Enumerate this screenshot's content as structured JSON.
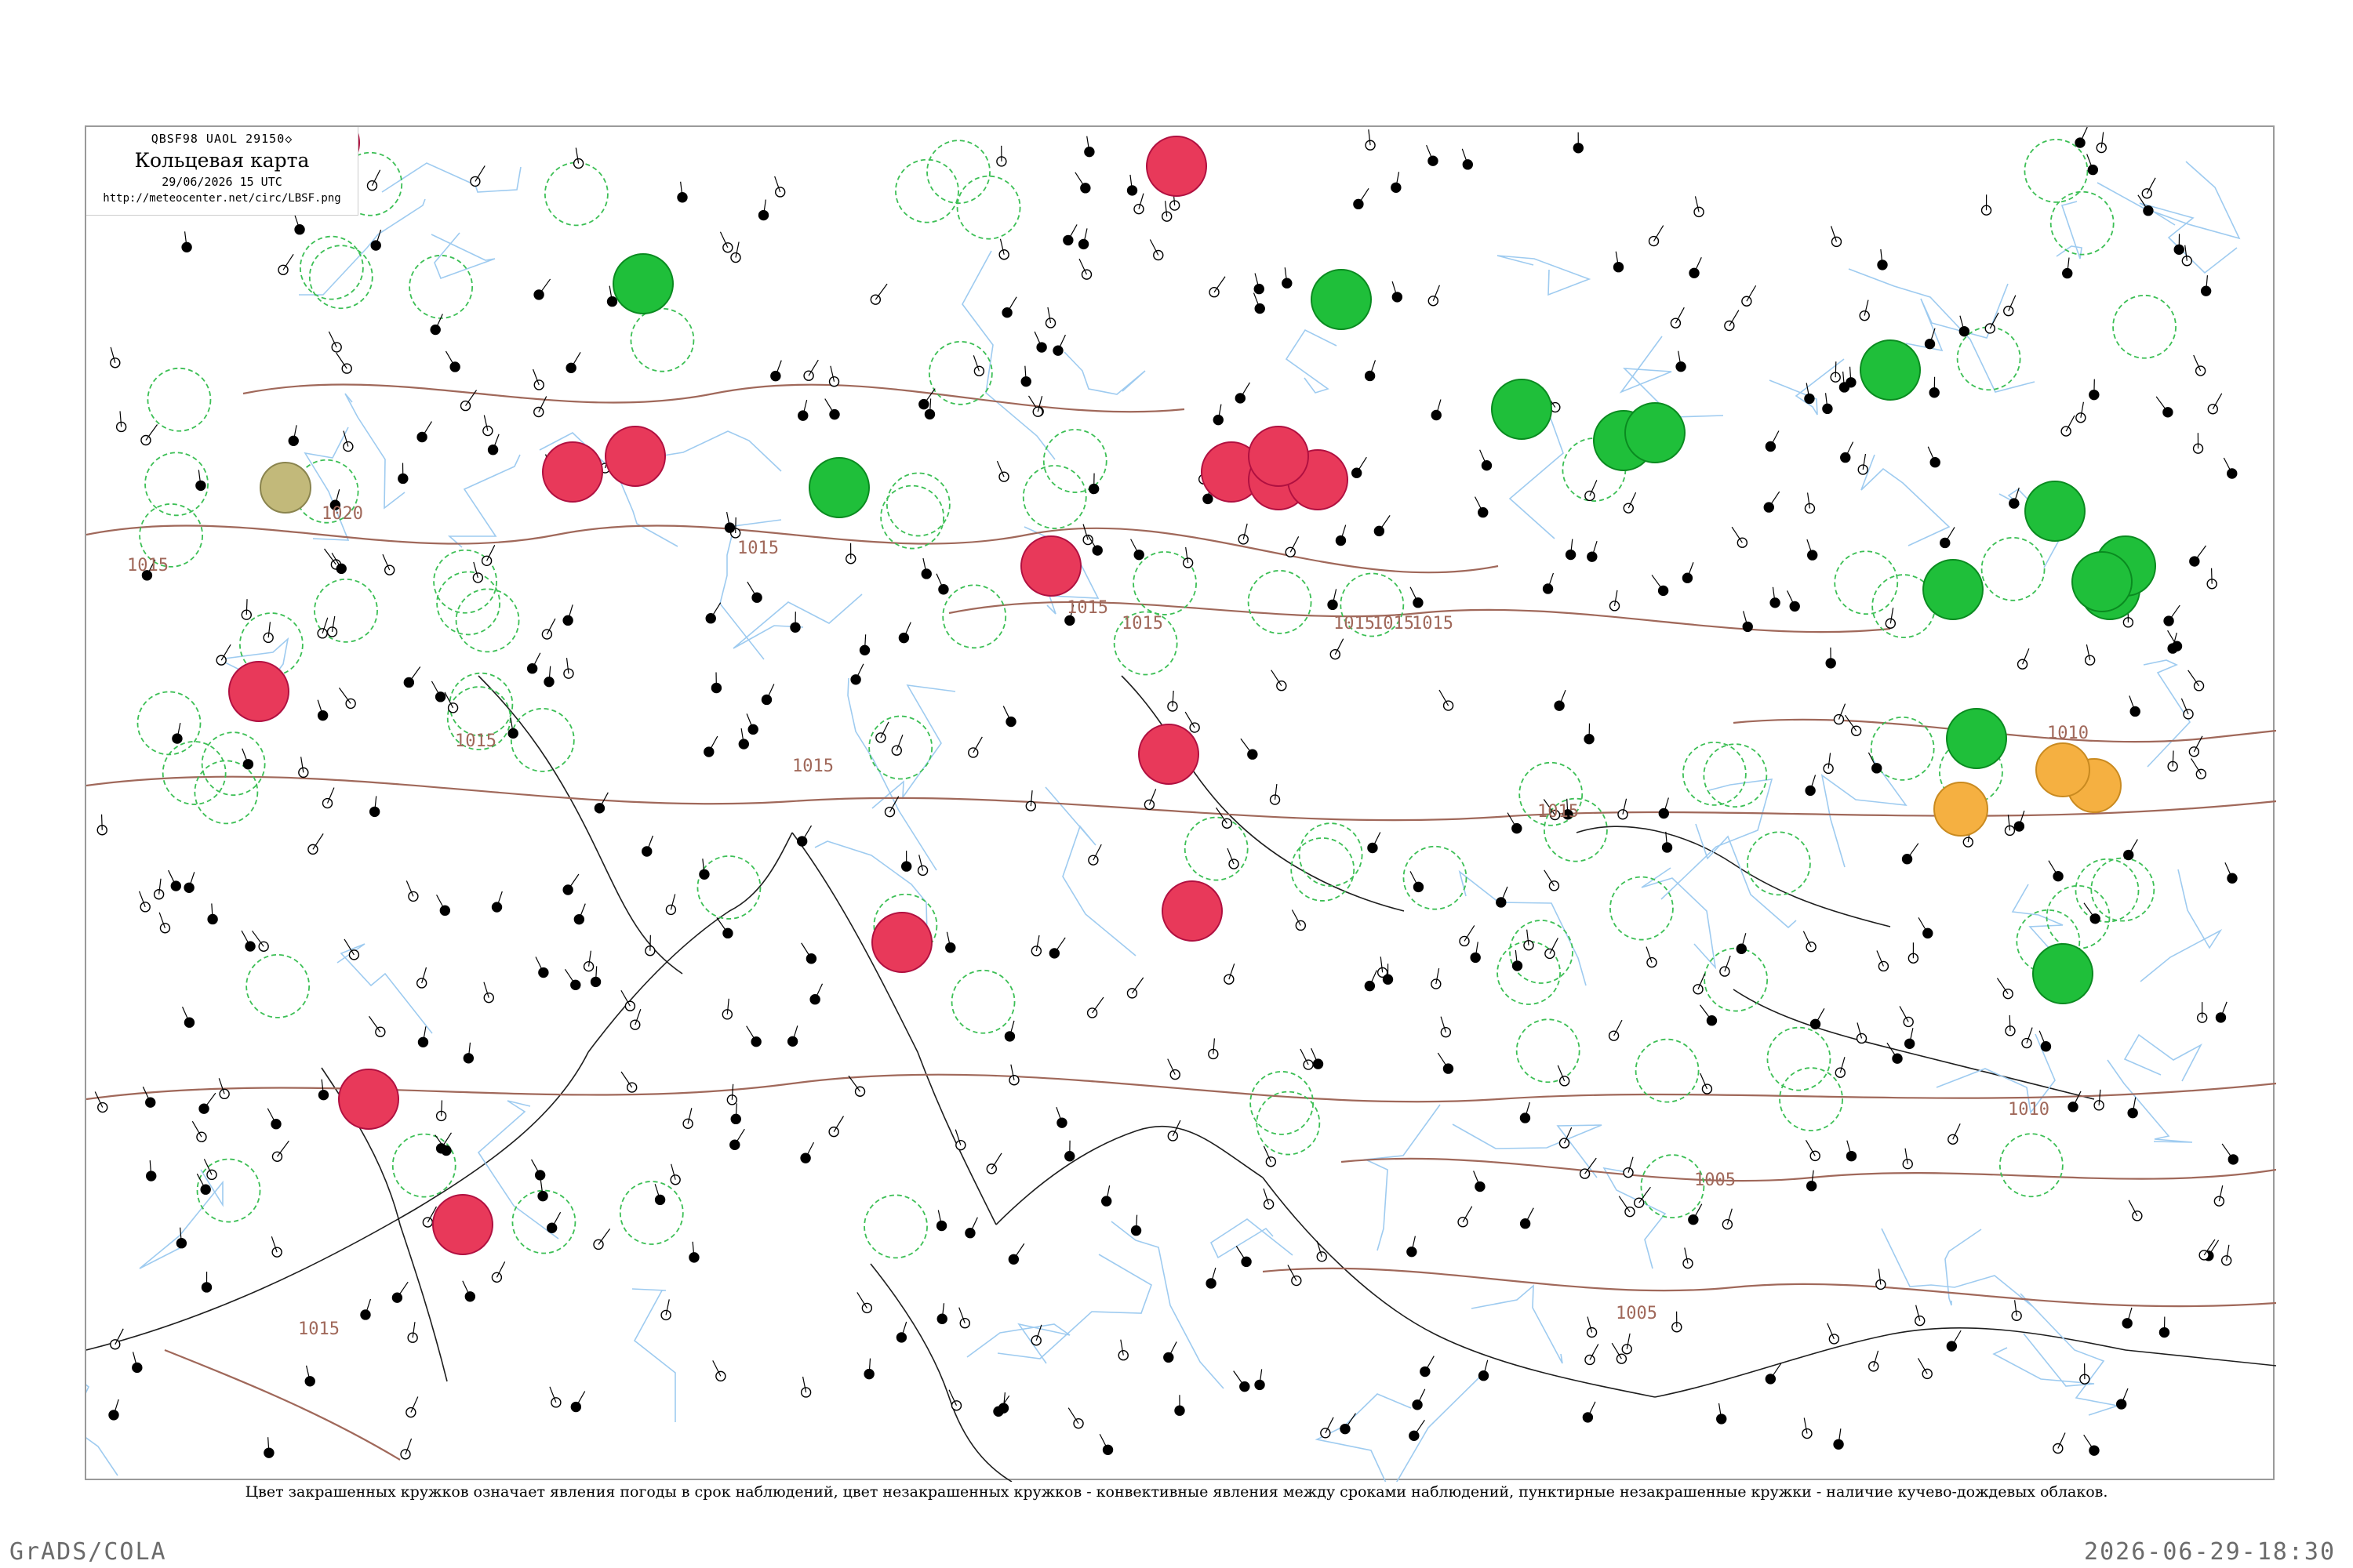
{
  "header": {
    "code": "QBSF98 UAOL 29150◇",
    "title": "Кольцевая карта",
    "date": "29/06/2026 15 UTC",
    "url": "http://meteocenter.net/circ/LBSF.png"
  },
  "isobars": {
    "labels": [
      "1015",
      "1020",
      "1015",
      "1015",
      "1015",
      "1015",
      "1015",
      "1015",
      "1015",
      "1015",
      "1015",
      "1010",
      "1010",
      "1005",
      "1005",
      "1015",
      "1015"
    ]
  },
  "colors": {
    "isobar": "#a0685a",
    "rivers": "#9ecbf0",
    "thunderstorm": "#e8395a",
    "shower": "#1fbf3a",
    "dust": "#f5b041",
    "haze": "#c2b97a",
    "dashed_ring": "#3cbf55"
  },
  "caption": "Цвет закрашенных кружков означает явления погоды в срок наблюдений, цвет незакрашенных кружков - конвективные явления между сроками наблюдений, пунктирные незакрашенные кружки - наличие кучево-дождевых облаков.",
  "footer": {
    "left": "GrADS/COLA",
    "right": "2026-06-29-18:30"
  }
}
